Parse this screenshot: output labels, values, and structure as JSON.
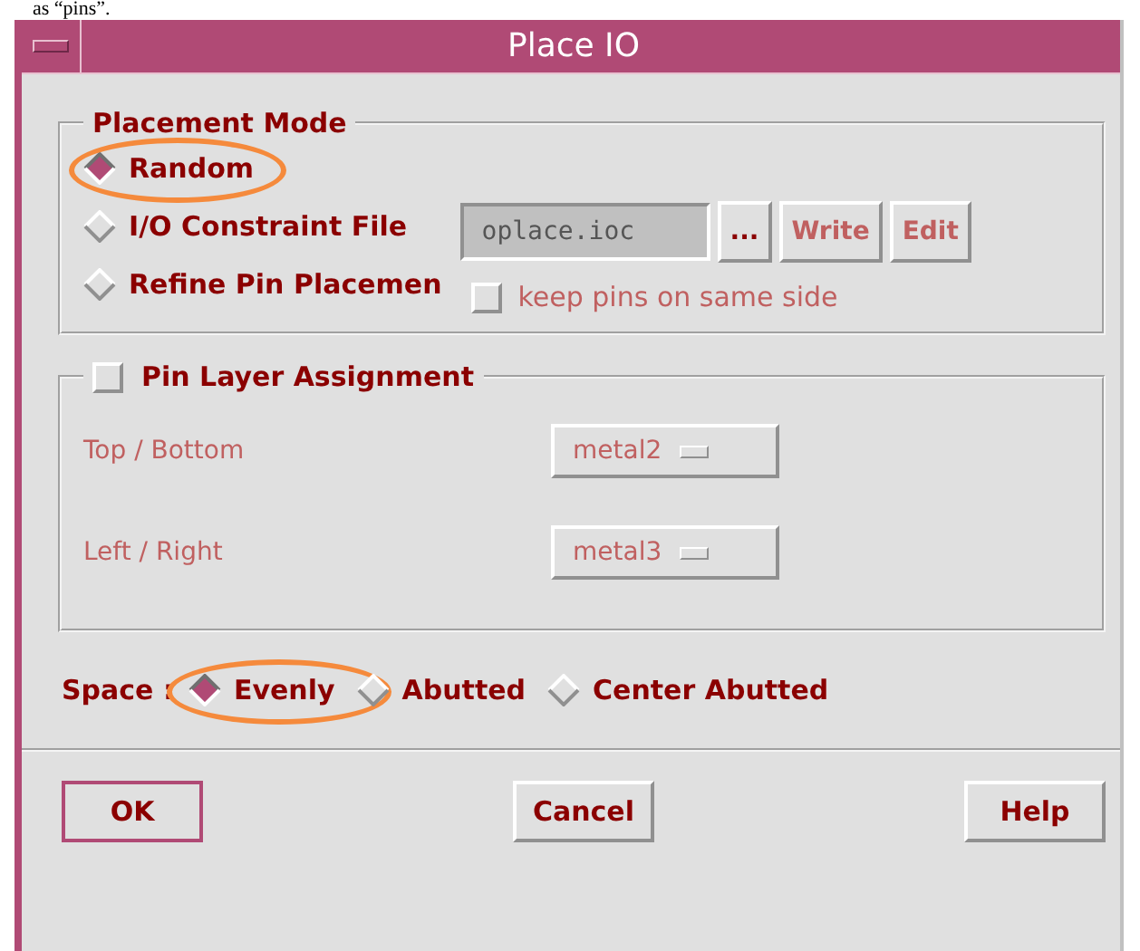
{
  "caption": "as “pins”.",
  "window": {
    "title": "Place IO"
  },
  "placement_mode": {
    "title": "Placement Mode",
    "options": [
      {
        "label": "Random",
        "selected": true,
        "highlighted": true
      },
      {
        "label": "I/O Constraint File",
        "selected": false,
        "highlighted": false
      },
      {
        "label": "Refine Pin Placemen",
        "selected": false,
        "highlighted": false
      }
    ],
    "file_field": {
      "value": "oplace.ioc",
      "disabled": true
    },
    "file_buttons": [
      {
        "label": "...",
        "disabled": false
      },
      {
        "label": "Write",
        "disabled": true
      },
      {
        "label": "Edit",
        "disabled": true
      }
    ],
    "keep_pins": {
      "label": "keep pins on same side",
      "checked": false,
      "disabled": true
    }
  },
  "pin_layer": {
    "title": "Pin Layer Assignment",
    "checked": false,
    "rows": [
      {
        "label": "Top / Bottom",
        "value": "metal2",
        "disabled": true
      },
      {
        "label": "Left / Right",
        "value": "metal3",
        "disabled": true
      }
    ]
  },
  "space": {
    "label": "Space :",
    "options": [
      {
        "label": "Evenly",
        "selected": true,
        "highlighted": true
      },
      {
        "label": "Abutted",
        "selected": false,
        "highlighted": false
      },
      {
        "label": "Center Abutted",
        "selected": false,
        "highlighted": false
      }
    ]
  },
  "buttons": [
    {
      "label": "OK",
      "default": true
    },
    {
      "label": "Cancel",
      "default": false
    },
    {
      "label": "Help",
      "default": false
    }
  ]
}
